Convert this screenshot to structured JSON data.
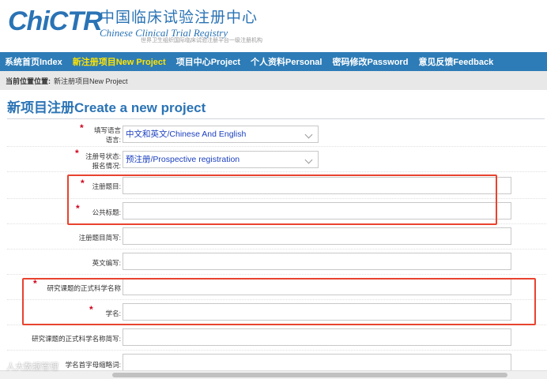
{
  "header": {
    "logo_mark": "ChiCTR",
    "logo_cn": "中国临床试验注册中心",
    "logo_en": "Chinese Clinical Trial Registry",
    "logo_sub": "世界卫生组织国际临床试验注册平台一级注册机构"
  },
  "nav": [
    {
      "label": "系统首页Index",
      "active": false
    },
    {
      "label": "新注册项目New Project",
      "active": true
    },
    {
      "label": "项目中心Project",
      "active": false
    },
    {
      "label": "个人资料Personal",
      "active": false
    },
    {
      "label": "密码修改Password",
      "active": false
    },
    {
      "label": "意见反馈Feedback",
      "active": false
    }
  ],
  "breadcrumb": {
    "prefix": "当前位置位置:",
    "current": "新注册项目New Project"
  },
  "page_title": "新项目注册Create a new project",
  "form": {
    "language_label_1": "填写语言",
    "language_label_2": "语言:",
    "language_value": "中文和英文/Chinese And English",
    "status_label_1": "注册号状态:",
    "status_label_2": "报名情况:",
    "status_value": "预注册/Prospective registration",
    "reg_title_label": "注册题目:",
    "public_title_label": "公共标题:",
    "title_abbr_label": "注册题目简写:",
    "en_abbr_label": "英文编写:",
    "sci_title_label": "研究课题的正式科学名称",
    "sci_name_label": "学名:",
    "sci_abbr_label": "研究课题的正式科学名称简写:",
    "acronym_label": "学名首字母缩略词:"
  },
  "watermark": "人大数据管理"
}
